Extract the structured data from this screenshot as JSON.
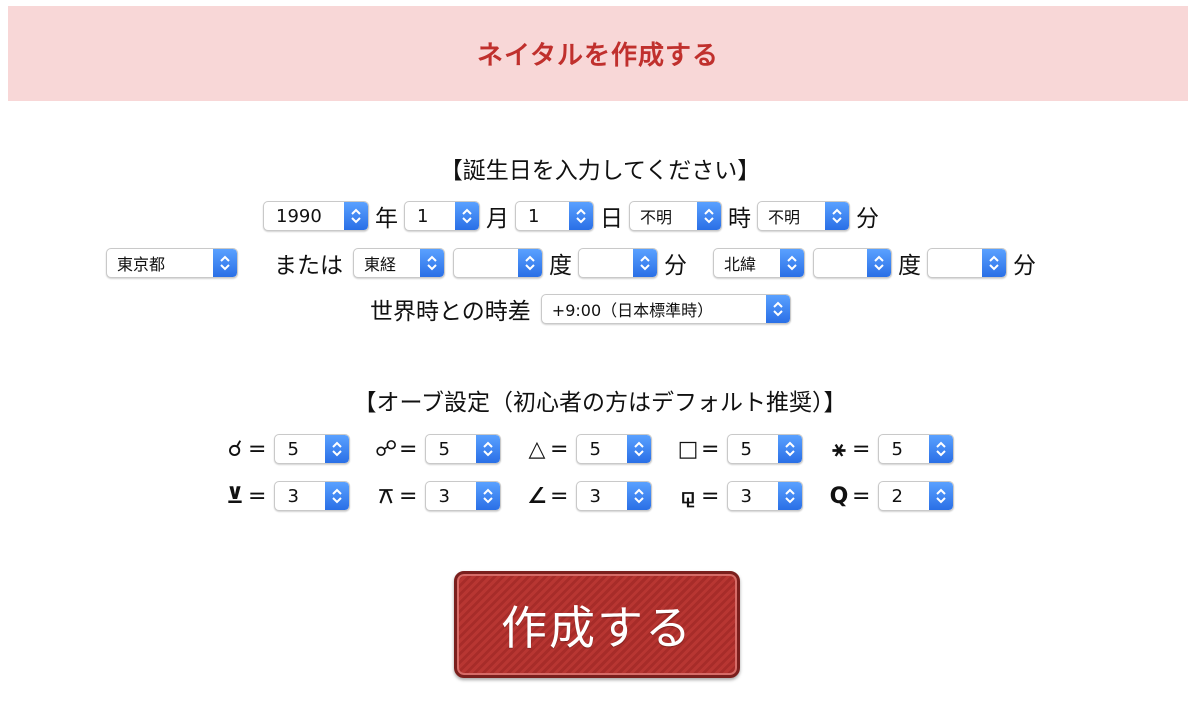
{
  "header": {
    "title": "ネイタルを作成する"
  },
  "birth": {
    "heading": "【誕生日を入力してください】",
    "year": "1990",
    "year_unit": "年",
    "month": "1",
    "month_unit": "月",
    "day": "1",
    "day_unit": "日",
    "hour": "不明",
    "hour_unit": "時",
    "minute": "不明",
    "minute_unit": "分"
  },
  "place": {
    "prefecture": "東京都",
    "or_label": "または",
    "longitude_dir": "東経",
    "longitude_deg": "",
    "deg_unit": "度",
    "longitude_min": "",
    "min_unit": "分",
    "latitude_dir": "北緯",
    "latitude_deg": "",
    "latitude_min": ""
  },
  "timezone": {
    "label": "世界時との時差",
    "value": "+9:00（日本標準時）"
  },
  "orb": {
    "heading": "【オーブ設定（初心者の方はデフォルト推奨）】",
    "eq": "=",
    "items": [
      {
        "glyph": "☌",
        "value": "5"
      },
      {
        "glyph": "☍",
        "value": "5"
      },
      {
        "glyph": "△",
        "value": "5"
      },
      {
        "glyph": "□",
        "value": "5"
      },
      {
        "glyph": "⚹",
        "value": "5"
      },
      {
        "glyph": "⊻",
        "value": "3"
      },
      {
        "glyph": "⚻",
        "value": "3"
      },
      {
        "glyph": "∠",
        "value": "3"
      },
      {
        "glyph": "⚼",
        "value": "3"
      },
      {
        "glyph": "Q",
        "value": "2"
      }
    ]
  },
  "submit": {
    "label": "作成する"
  },
  "colors": {
    "header_bg": "#f8d7d7",
    "header_text": "#c0302d",
    "button": "#b83632",
    "select_arrow": "#2a6fe6"
  }
}
